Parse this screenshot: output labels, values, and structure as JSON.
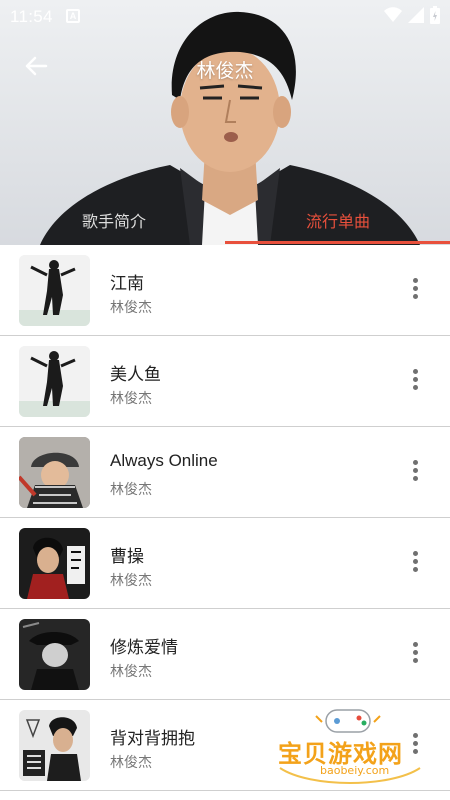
{
  "status_bar": {
    "time": "11:54",
    "notification_letter": "A"
  },
  "header": {
    "title": "林俊杰",
    "tabs": [
      {
        "label": "歌手简介",
        "active": false
      },
      {
        "label": "流行单曲",
        "active": true
      }
    ],
    "accent_color": "#e8503c"
  },
  "songs": [
    {
      "title": "江南",
      "artist": "林俊杰"
    },
    {
      "title": "美人鱼",
      "artist": "林俊杰"
    },
    {
      "title": "Always Online",
      "artist": "林俊杰"
    },
    {
      "title": "曹操",
      "artist": "林俊杰"
    },
    {
      "title": "修炼爱情",
      "artist": "林俊杰"
    },
    {
      "title": "背对背拥抱",
      "artist": "林俊杰"
    }
  ],
  "watermark": {
    "name": "宝贝游戏网",
    "url": "baobeiy.com"
  }
}
